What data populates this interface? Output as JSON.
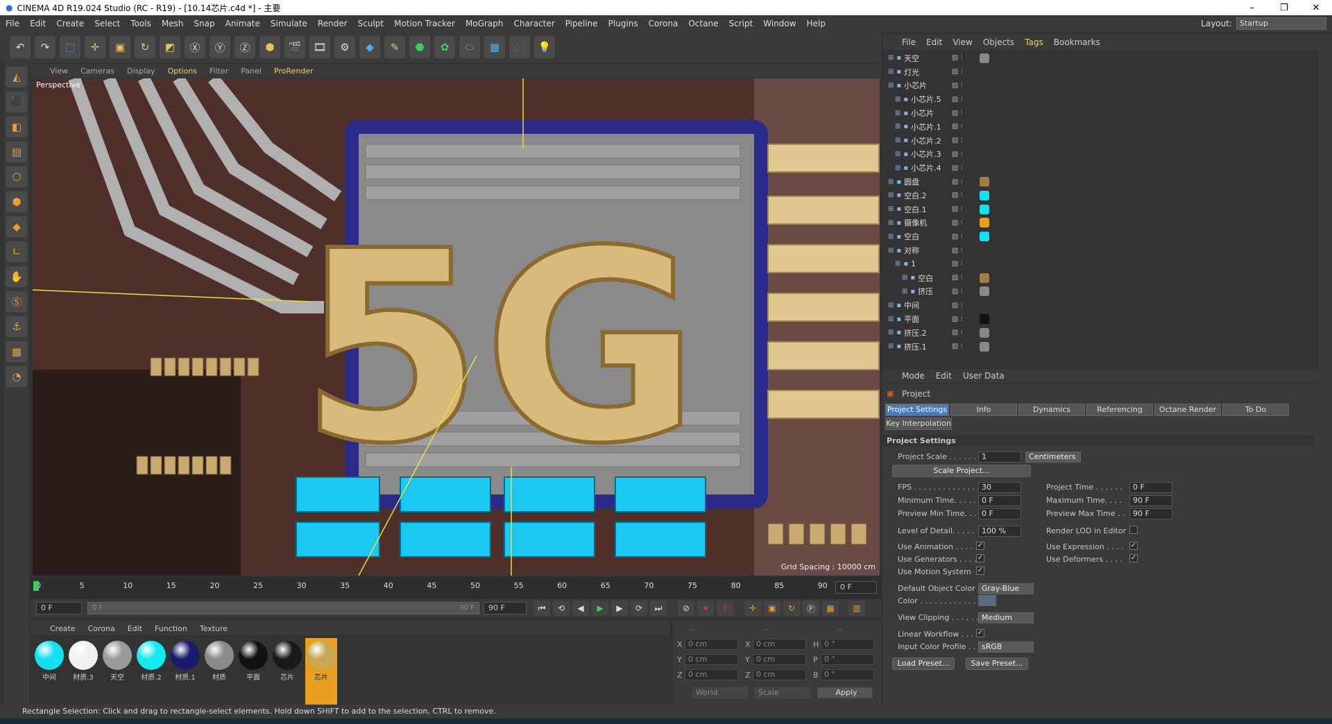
{
  "title": "CINEMA 4D R19.024 Studio (RC - R19) - [10.14芯片.c4d *] - 主要",
  "menu": [
    "File",
    "Edit",
    "Create",
    "Select",
    "Tools",
    "Mesh",
    "Snap",
    "Animate",
    "Simulate",
    "Render",
    "Sculpt",
    "Motion Tracker",
    "MoGraph",
    "Character",
    "Pipeline",
    "Plugins",
    "Corona",
    "Octane",
    "Script",
    "Window",
    "Help"
  ],
  "layout_label": "Layout:",
  "layout_value": "Startup",
  "viewport_menu": [
    "View",
    "Cameras",
    "Display",
    "Options",
    "Filter",
    "Panel",
    "ProRender"
  ],
  "viewport_label": "Perspective",
  "grid_spacing": "Grid Spacing : 10000 cm",
  "timeline_ticks": [
    "0",
    "5",
    "10",
    "15",
    "20",
    "25",
    "30",
    "35",
    "40",
    "45",
    "50",
    "55",
    "60",
    "65",
    "70",
    "75",
    "80",
    "85",
    "90"
  ],
  "time_current": "0 F",
  "time_start": "0 F",
  "time_slider_start": "0 F",
  "time_slider_end": "90 F",
  "time_end": "90 F",
  "material_menu": [
    "Create",
    "Corona",
    "Edit",
    "Function",
    "Texture"
  ],
  "materials": [
    {
      "name": "中间",
      "color": "#13e0f0"
    },
    {
      "name": "材质.3",
      "color": "#f0f0f0"
    },
    {
      "name": "天空",
      "color": "#9a9a9a"
    },
    {
      "name": "材质.2",
      "color": "#16e8f0"
    },
    {
      "name": "材质.1",
      "color": "#1a1a6a"
    },
    {
      "name": "材质",
      "color": "#8a8a8a"
    },
    {
      "name": "平面",
      "color": "#111111"
    },
    {
      "name": "芯片",
      "color": "#1a1a1a"
    },
    {
      "name": "芯片",
      "color": "#c8a850"
    }
  ],
  "coords": {
    "headers": [
      "--",
      "--",
      "--"
    ],
    "rows": [
      {
        "a1": "X",
        "v1": "0 cm",
        "a2": "X",
        "v2": "0 cm",
        "a3": "H",
        "v3": "0 °"
      },
      {
        "a1": "Y",
        "v1": "0 cm",
        "a2": "Y",
        "v2": "0 cm",
        "a3": "P",
        "v3": "0 °"
      },
      {
        "a1": "Z",
        "v1": "0 cm",
        "a2": "Z",
        "v2": "0 cm",
        "a3": "B",
        "v3": "0 °"
      }
    ],
    "world": "World",
    "scale": "Scale",
    "apply": "Apply"
  },
  "status": "Rectangle Selection: Click and drag to rectangle-select elements. Hold down SHIFT to add to the selection, CTRL to remove.",
  "object_menu": [
    "File",
    "Edit",
    "View",
    "Objects",
    "Tags",
    "Bookmarks"
  ],
  "objects": [
    {
      "name": "天空",
      "indent": 0,
      "tag": "#888"
    },
    {
      "name": "灯光",
      "indent": 0,
      "tag": ""
    },
    {
      "name": "小芯片",
      "indent": 0,
      "tag": ""
    },
    {
      "name": "小芯片.5",
      "indent": 1,
      "tag": ""
    },
    {
      "name": "小芯片",
      "indent": 1,
      "tag": ""
    },
    {
      "name": "小芯片.1",
      "indent": 1,
      "tag": ""
    },
    {
      "name": "小芯片.2",
      "indent": 1,
      "tag": ""
    },
    {
      "name": "小芯片.3",
      "indent": 1,
      "tag": ""
    },
    {
      "name": "小芯片.4",
      "indent": 1,
      "tag": ""
    },
    {
      "name": "圆盘",
      "indent": 0,
      "tag": "#a08040"
    },
    {
      "name": "空白.2",
      "indent": 0,
      "tag": "#13e0f0"
    },
    {
      "name": "空白.1",
      "indent": 0,
      "tag": "#13e0f0"
    },
    {
      "name": "摄像机",
      "indent": 0,
      "tag": "#e8a020"
    },
    {
      "name": "空白",
      "indent": 0,
      "tag": "#13e0f0"
    },
    {
      "name": "对称",
      "indent": 0,
      "tag": ""
    },
    {
      "name": "1",
      "indent": 1,
      "tag": ""
    },
    {
      "name": "空白",
      "indent": 2,
      "tag": "#a08040"
    },
    {
      "name": "挤压",
      "indent": 2,
      "tag": "#888"
    },
    {
      "name": "中间",
      "indent": 0,
      "tag": ""
    },
    {
      "name": "平面",
      "indent": 0,
      "tag": "#111"
    },
    {
      "name": "挤压.2",
      "indent": 0,
      "tag": "#888"
    },
    {
      "name": "挤压.1",
      "indent": 0,
      "tag": "#888"
    }
  ],
  "attr_menu": [
    "Mode",
    "Edit",
    "User Data"
  ],
  "attr_title": "Project",
  "tabs": [
    "Project Settings",
    "Info",
    "Dynamics",
    "Referencing",
    "Octane Render",
    "To Do"
  ],
  "tab2": "Key Interpolation",
  "section": "Project Settings",
  "project_scale_label": "Project Scale . . . . . .",
  "project_scale": "1",
  "units": "Centimeters",
  "scale_btn": "Scale Project...",
  "fps_label": "FPS . . . . . . . . . . . . . .",
  "fps": "30",
  "ptime_label": "Project Time . . . . . .",
  "ptime": "0 F",
  "mintime_label": "Minimum Time. . . . .",
  "mintime": "0 F",
  "maxtime_label": "Maximum Time. . . .",
  "maxtime": "90 F",
  "pmin_label": "Preview Min Time. . .",
  "pmin": "0 F",
  "pmax_label": "Preview Max Time . .",
  "pmax": "90 F",
  "lod_label": "Level of Detail. . . . .",
  "lod": "100 %",
  "renderlod_label": "Render LOD in Editor",
  "useanim": "Use Animation . . . . .",
  "useexpr": "Use Expression . . . .",
  "usegen": "Use Generators . . . .",
  "usedef": "Use Deformers . . . .",
  "usemotion": "Use Motion System",
  "defcolor_label": "Default Object Color",
  "defcolor": "Gray-Blue",
  "color_label": "Color . . . . . . . . . . . .",
  "viewclip_label": "View Clipping . . . . . .",
  "viewclip": "Medium",
  "linear_label": "Linear Workflow . . . .",
  "icp_label": "Input Color Profile . .",
  "icp": "sRGB",
  "load_preset": "Load Preset...",
  "save_preset": "Save Preset...",
  "check": "✓"
}
